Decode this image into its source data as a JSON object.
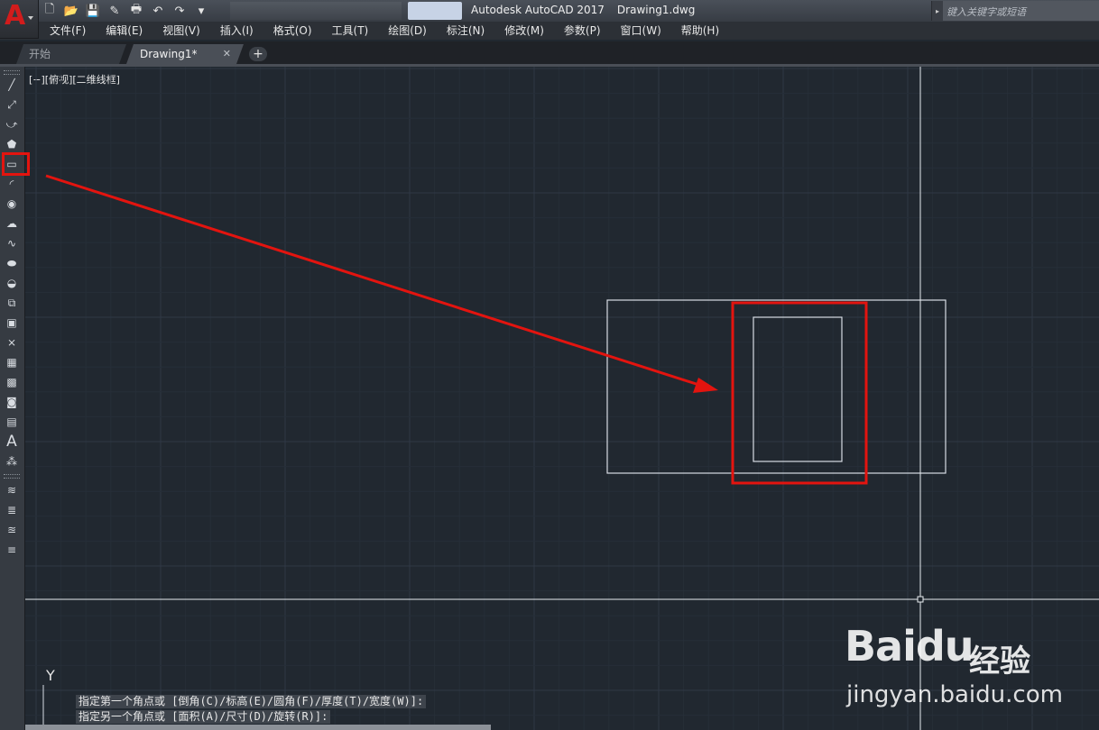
{
  "title_bar": {
    "app_title": "Autodesk AutoCAD 2017",
    "file_title": "Drawing1.dwg",
    "search_placeholder": "键入关键字或短语",
    "app_logo": "A"
  },
  "quick_access": [
    {
      "icon": "new-icon",
      "glyph": "🗋"
    },
    {
      "icon": "open-icon",
      "glyph": "📂"
    },
    {
      "icon": "save-icon",
      "glyph": "💾"
    },
    {
      "icon": "save-as-icon",
      "glyph": "✎"
    },
    {
      "icon": "plot-icon",
      "glyph": "🖶"
    },
    {
      "icon": "undo-icon",
      "glyph": "↶"
    },
    {
      "icon": "redo-icon",
      "glyph": "↷"
    },
    {
      "icon": "customize-icon",
      "glyph": "▾"
    }
  ],
  "menu": [
    "文件(F)",
    "编辑(E)",
    "视图(V)",
    "插入(I)",
    "格式(O)",
    "工具(T)",
    "绘图(D)",
    "标注(N)",
    "修改(M)",
    "参数(P)",
    "窗口(W)",
    "帮助(H)"
  ],
  "tabs": {
    "start": "开始",
    "drawing": "Drawing1*",
    "close_glyph": "✕",
    "add_glyph": "+"
  },
  "viewport_label": "[−][俯视][二维线框]",
  "draw_tools": [
    {
      "name": "line-icon",
      "glyph": "╱"
    },
    {
      "name": "construction-line-icon",
      "glyph": "⤢"
    },
    {
      "name": "polyline-icon",
      "glyph": "⤻"
    },
    {
      "name": "polygon-icon",
      "glyph": "⬟"
    },
    {
      "name": "rectangle-icon",
      "glyph": "▭"
    },
    {
      "name": "arc-icon",
      "glyph": "◜"
    },
    {
      "name": "circle-icon",
      "glyph": "◉"
    },
    {
      "name": "revision-cloud-icon",
      "glyph": "☁"
    },
    {
      "name": "spline-icon",
      "glyph": "∿"
    },
    {
      "name": "ellipse-icon",
      "glyph": "⬬"
    },
    {
      "name": "ellipse-arc-icon",
      "glyph": "◒"
    },
    {
      "name": "insert-block-icon",
      "glyph": "⧉"
    },
    {
      "name": "make-block-icon",
      "glyph": "▣"
    },
    {
      "name": "point-icon",
      "glyph": "⨯"
    },
    {
      "name": "hatch-icon",
      "glyph": "▦"
    },
    {
      "name": "gradient-icon",
      "glyph": "▩"
    },
    {
      "name": "region-icon",
      "glyph": "◙"
    },
    {
      "name": "table-icon",
      "glyph": "▤"
    },
    {
      "name": "multiline-text-icon",
      "glyph": "A"
    },
    {
      "name": "add-selected-icon",
      "glyph": "⁂"
    }
  ],
  "layer_tools": [
    {
      "name": "layer-properties-icon",
      "glyph": "≋"
    },
    {
      "name": "layer-state-icon",
      "glyph": "≣"
    },
    {
      "name": "layer-previous-icon",
      "glyph": "≊"
    },
    {
      "name": "layer-match-icon",
      "glyph": "≡"
    }
  ],
  "command_history": [
    "指定第一个角点或 [倒角(C)/标高(E)/圆角(F)/厚度(T)/宽度(W)]:",
    "指定另一个角点或 [面积(A)/尺寸(D)/旋转(R)]:"
  ],
  "ucs_y_label": "Y",
  "watermark": {
    "logo": "Bai",
    "logo_du": "du",
    "logo_cn": "经验",
    "url": "jingyan.baidu.com"
  },
  "colors": {
    "canvas": "#212830",
    "annotation": "#e3140f",
    "geometry": "#d8dde4",
    "crosshair": "#e8ecf0"
  }
}
